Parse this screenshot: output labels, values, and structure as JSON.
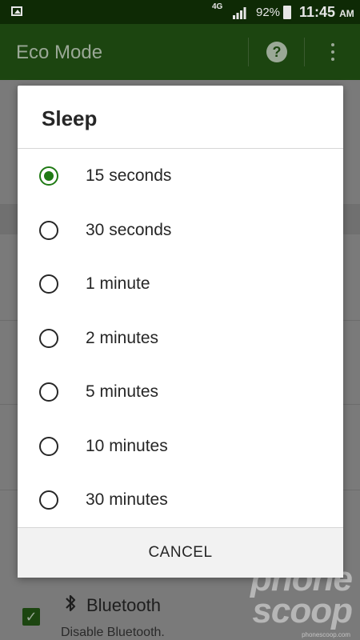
{
  "status_bar": {
    "network": "4G",
    "battery_percent": "92%",
    "time": "11:45",
    "ampm": "AM"
  },
  "app_bar": {
    "title": "Eco Mode"
  },
  "background_list": {
    "bluetooth_title": "Bluetooth",
    "bluetooth_subtitle": "Disable Bluetooth.",
    "bluetooth_checked": true
  },
  "watermark": {
    "line1": "phone",
    "line2": "scoop",
    "footer": "phonescoop.com"
  },
  "dialog": {
    "title": "Sleep",
    "options": [
      {
        "label": "15 seconds",
        "selected": true
      },
      {
        "label": "30 seconds",
        "selected": false
      },
      {
        "label": "1 minute",
        "selected": false
      },
      {
        "label": "2 minutes",
        "selected": false
      },
      {
        "label": "5 minutes",
        "selected": false
      },
      {
        "label": "10 minutes",
        "selected": false
      },
      {
        "label": "30 minutes",
        "selected": false
      }
    ],
    "cancel_label": "CANCEL"
  },
  "colors": {
    "accent": "#1f7a14",
    "app_bar": "#1c4510",
    "status_bar": "#0e2a05"
  }
}
